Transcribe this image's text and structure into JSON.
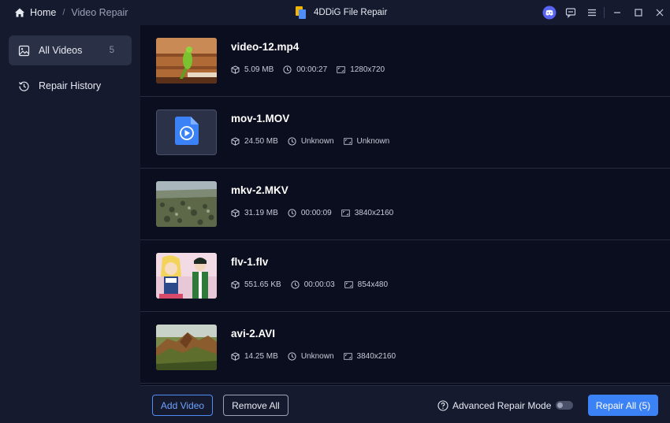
{
  "titlebar": {
    "home_label": "Home",
    "separator": "/",
    "current_label": "Video Repair",
    "app_title": "4DDiG File Repair"
  },
  "sidebar": {
    "items": [
      {
        "label": "All Videos",
        "count": "5",
        "icon": "image-icon"
      },
      {
        "label": "Repair History",
        "icon": "history-icon"
      }
    ]
  },
  "videos": [
    {
      "name": "video-12.mp4",
      "size": "5.09 MB",
      "duration": "00:00:27",
      "resolution": "1280x720",
      "thumb": "parrot"
    },
    {
      "name": "mov-1.MOV",
      "size": "24.50 MB",
      "duration": "Unknown",
      "resolution": "Unknown",
      "thumb": "placeholder"
    },
    {
      "name": "mkv-2.MKV",
      "size": "31.19 MB",
      "duration": "00:00:09",
      "resolution": "3840x2160",
      "thumb": "forest"
    },
    {
      "name": "flv-1.flv",
      "size": "551.65 KB",
      "duration": "00:00:03",
      "resolution": "854x480",
      "thumb": "anime"
    },
    {
      "name": "avi-2.AVI",
      "size": "14.25 MB",
      "duration": "Unknown",
      "resolution": "3840x2160",
      "thumb": "mountain"
    }
  ],
  "footer": {
    "add_label": "Add Video",
    "remove_label": "Remove All",
    "advanced_label": "Advanced Repair Mode",
    "repair_label": "Repair All (5)"
  },
  "colors": {
    "accent": "#3b82f6",
    "background": "#0b0e1e",
    "panel": "#151a2e"
  }
}
